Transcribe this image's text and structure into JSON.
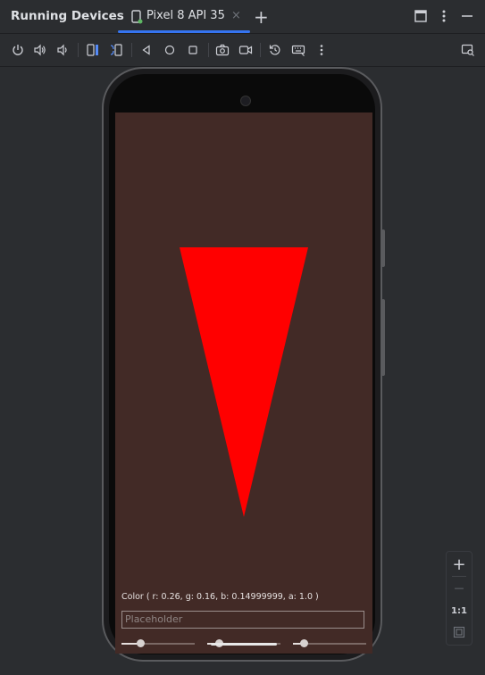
{
  "window": {
    "title": "Running Devices",
    "tab_label": "Pixel 8 API 35",
    "tab_close": "×",
    "add_tab": "+"
  },
  "icons": {
    "titlebar": [
      "device-icon",
      "close-icon",
      "add-tab-icon",
      "window-layout-icon",
      "more-vert-icon",
      "minimize-icon"
    ],
    "toolbar": [
      "power-icon",
      "volume-up-icon",
      "volume-down-icon",
      "rotate-left-icon",
      "rotate-right-icon",
      "back-icon",
      "home-icon",
      "overview-icon",
      "screenshot-icon",
      "screen-record-icon",
      "reset-icon",
      "keyboard-icon",
      "more-vert-icon",
      "device-mirror-icon"
    ],
    "zoom": [
      "zoom-in-icon",
      "zoom-out-icon",
      "zoom-fit-icon"
    ]
  },
  "zoom": {
    "plus": "+",
    "minus": "—",
    "actual": "1:1"
  },
  "app": {
    "background_color": "#422a26",
    "triangle_color": "#ff0000",
    "color_label": "Color ( r: 0.26, g: 0.16, b: 0.14999999, a: 1.0 )",
    "input_placeholder": "Placeholder",
    "sliders": [
      {
        "name": "red",
        "value": 0.26
      },
      {
        "name": "green",
        "value": 0.16
      },
      {
        "name": "blue",
        "value": 0.15
      }
    ]
  },
  "colors": {
    "accent": "#3574f0",
    "ide_background": "#2b2d30",
    "text": "#dfe1e5"
  }
}
